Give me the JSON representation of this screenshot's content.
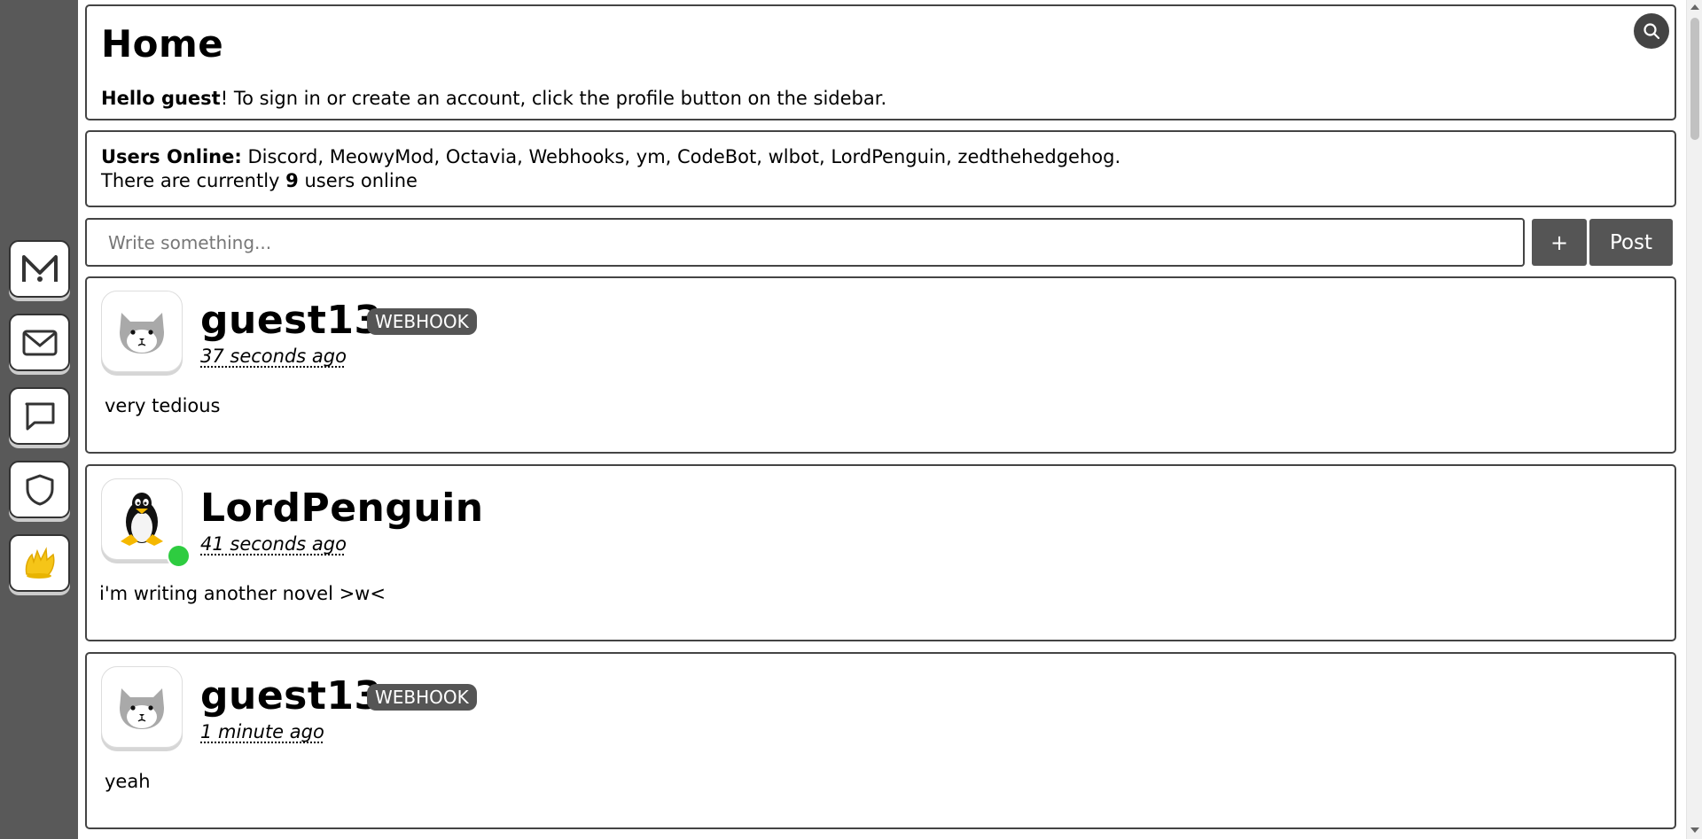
{
  "home": {
    "title": "Home",
    "greeting_name": "Hello guest",
    "greeting_rest": "! To sign in or create an account, click the profile button on the sidebar."
  },
  "online": {
    "label": "Users Online:",
    "users": " Discord, MeowyMod, Octavia, Webhooks, ym, CodeBot, wlbot, LordPenguin, zedthehedgehog.",
    "count_prefix": "There are currently ",
    "count": "9",
    "count_suffix": " users online"
  },
  "composer": {
    "placeholder": "Write something...",
    "plus_label": "+",
    "post_label": "Post"
  },
  "sidebar": {
    "items": [
      {
        "icon": "meower-logo-icon"
      },
      {
        "icon": "mail-icon"
      },
      {
        "icon": "chat-icon"
      },
      {
        "icon": "shield-icon"
      },
      {
        "icon": "profile-avatar-icon"
      }
    ]
  },
  "posts": [
    {
      "username": "guest13",
      "badge": "WEBHOOK",
      "time": "37 seconds ago",
      "body": "very tedious",
      "avatar": "cat-avatar-icon"
    },
    {
      "username": "LordPenguin",
      "badge": "",
      "time": "41 seconds ago",
      "body": "i'm writing another novel >w<",
      "avatar": "penguin-avatar-icon",
      "online": true
    },
    {
      "username": "guest13",
      "badge": "WEBHOOK",
      "time": "1 minute ago",
      "body": "yeah",
      "avatar": "cat-avatar-icon"
    }
  ],
  "colors": {
    "sidebar_bg": "#595959",
    "button_bg": "#555555",
    "online_green": "#2ecc40"
  }
}
